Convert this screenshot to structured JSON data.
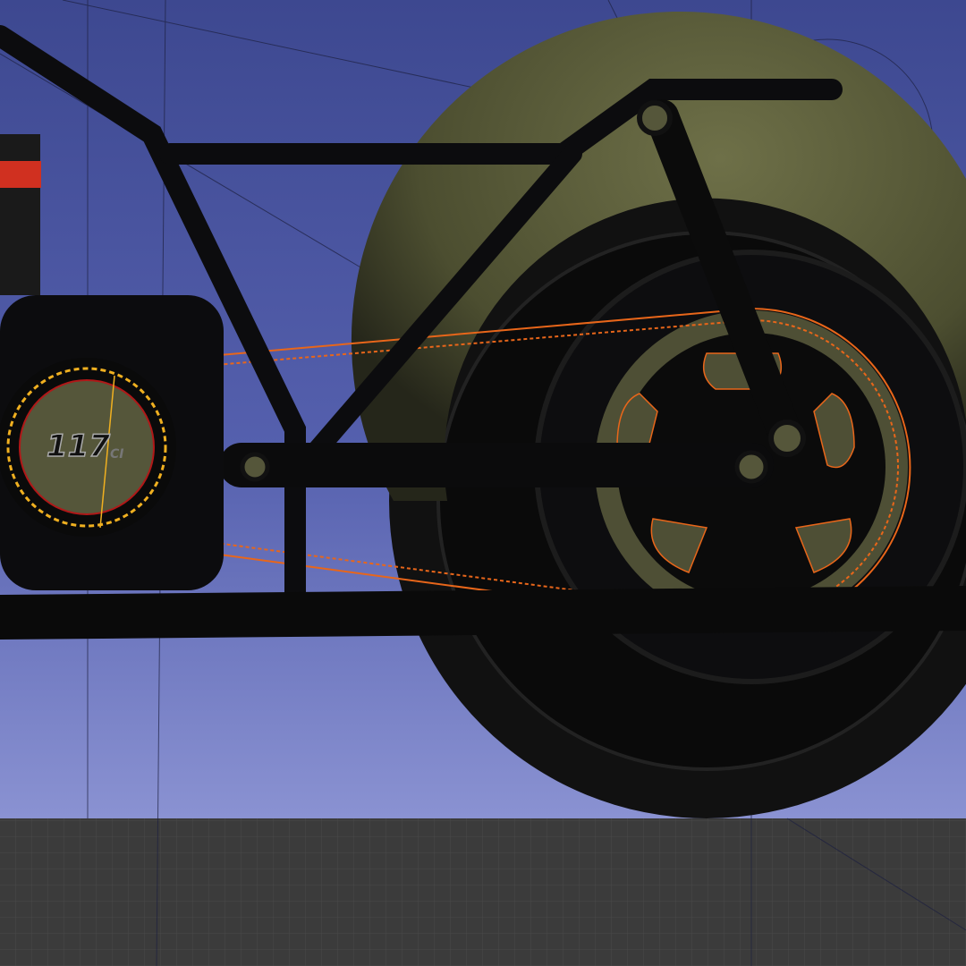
{
  "viewport": {
    "engine_badge": {
      "number": "117",
      "suffix": "CI"
    },
    "colors": {
      "sky_top": "#3d4890",
      "sky_bottom": "#8a92d2",
      "floor": "#3b3b3b",
      "belt_outline": "#e8661a",
      "pulley_teeth": "#f0b020",
      "fender": "#5a5c38",
      "frame": "#0c0c0e"
    }
  }
}
